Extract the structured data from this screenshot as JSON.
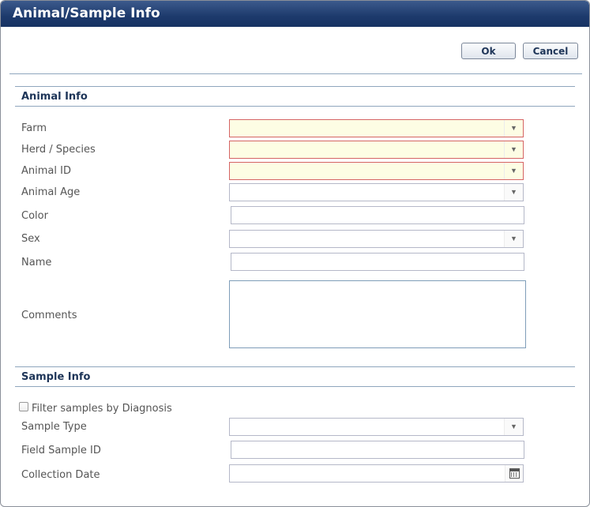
{
  "window": {
    "title": "Animal/Sample Info"
  },
  "buttons": {
    "ok": "Ok",
    "cancel": "Cancel"
  },
  "animal_info": {
    "section_title": "Animal Info",
    "fields": {
      "farm": {
        "label": "Farm",
        "value": "",
        "required": true
      },
      "herd_species": {
        "label": "Herd / Species",
        "value": "",
        "required": true
      },
      "animal_id": {
        "label": "Animal ID",
        "value": "",
        "required": true
      },
      "animal_age": {
        "label": "Animal Age",
        "value": ""
      },
      "color": {
        "label": "Color",
        "value": ""
      },
      "sex": {
        "label": "Sex",
        "value": ""
      },
      "name": {
        "label": "Name",
        "value": ""
      },
      "comments": {
        "label": "Comments",
        "value": ""
      }
    }
  },
  "sample_info": {
    "section_title": "Sample Info",
    "filter_checkbox": {
      "label": "Filter samples by Diagnosis",
      "checked": false
    },
    "fields": {
      "sample_type": {
        "label": "Sample Type",
        "value": ""
      },
      "field_sample_id": {
        "label": "Field Sample ID",
        "value": ""
      },
      "collection_date": {
        "label": "Collection Date",
        "value": ""
      }
    }
  },
  "icons": {
    "dropdown": "chevron-down-icon",
    "calendar": "calendar-icon"
  },
  "colors": {
    "title_bar": "#1d3a6c",
    "required_border": "#d56464",
    "required_fill": "#fdfde4",
    "section_title": "#1e3558"
  }
}
